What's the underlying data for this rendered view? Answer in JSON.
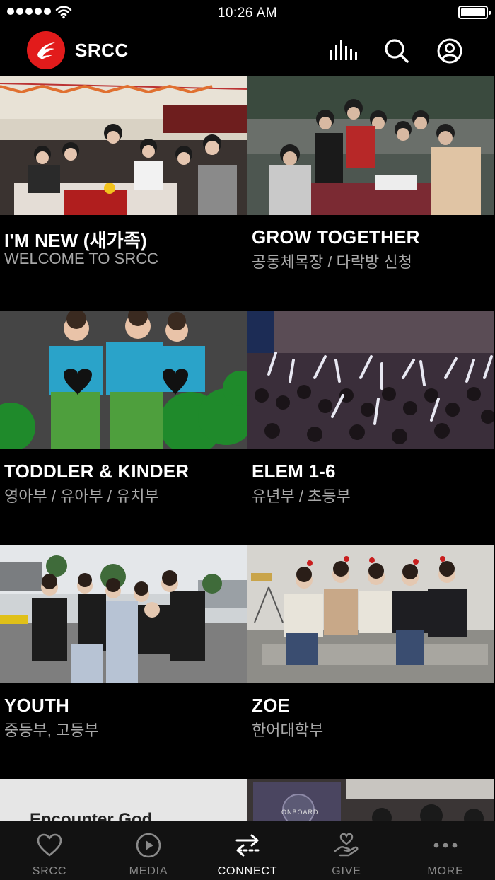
{
  "status_bar": {
    "time": "10:26 AM"
  },
  "header": {
    "app_title": "SRCC",
    "icons": [
      "chart-bars-icon",
      "search-icon",
      "account-icon"
    ]
  },
  "colors": {
    "background": "#000000",
    "brand_red": "#e21b1b",
    "subtitle_gray": "#a8a8a8",
    "tab_inactive": "#8a8a8a",
    "tab_active": "#ffffff"
  },
  "cards": [
    {
      "title": "I'M NEW (새가족)",
      "subtitle": "WELCOME TO SRCC",
      "photo": "group-dinner-photo"
    },
    {
      "title": "GROW TOGETHER",
      "subtitle": "공동체목장 / 다락방 신청",
      "photo": "outdoor-group-photo"
    },
    {
      "title": "TODDLER & KINDER",
      "subtitle": "영아부 / 유아부 / 유치부",
      "photo": "kids-performance-photo"
    },
    {
      "title": "ELEM 1-6",
      "subtitle": "유년부 / 초등부",
      "photo": "glowstick-crowd-photo"
    },
    {
      "title": "YOUTH",
      "subtitle": "중등부, 고등부",
      "photo": "youth-group-photo"
    },
    {
      "title": "ZOE",
      "subtitle": "한어대학부",
      "photo": "college-group-photo"
    },
    {
      "title": "",
      "subtitle": "",
      "photo": "encounter-god-banner",
      "photo_text": "Encounter God"
    },
    {
      "title": "",
      "subtitle": "",
      "photo": "onboard-event-photo",
      "photo_text": "ONBOARD"
    }
  ],
  "tabbar": {
    "tabs": [
      {
        "label": "SRCC",
        "icon": "heart-icon",
        "active": false
      },
      {
        "label": "MEDIA",
        "icon": "play-circle-icon",
        "active": false
      },
      {
        "label": "CONNECT",
        "icon": "swap-arrows-icon",
        "active": true
      },
      {
        "label": "GIVE",
        "icon": "heart-hand-icon",
        "active": false
      },
      {
        "label": "MORE",
        "icon": "more-dots-icon",
        "active": false
      }
    ]
  }
}
